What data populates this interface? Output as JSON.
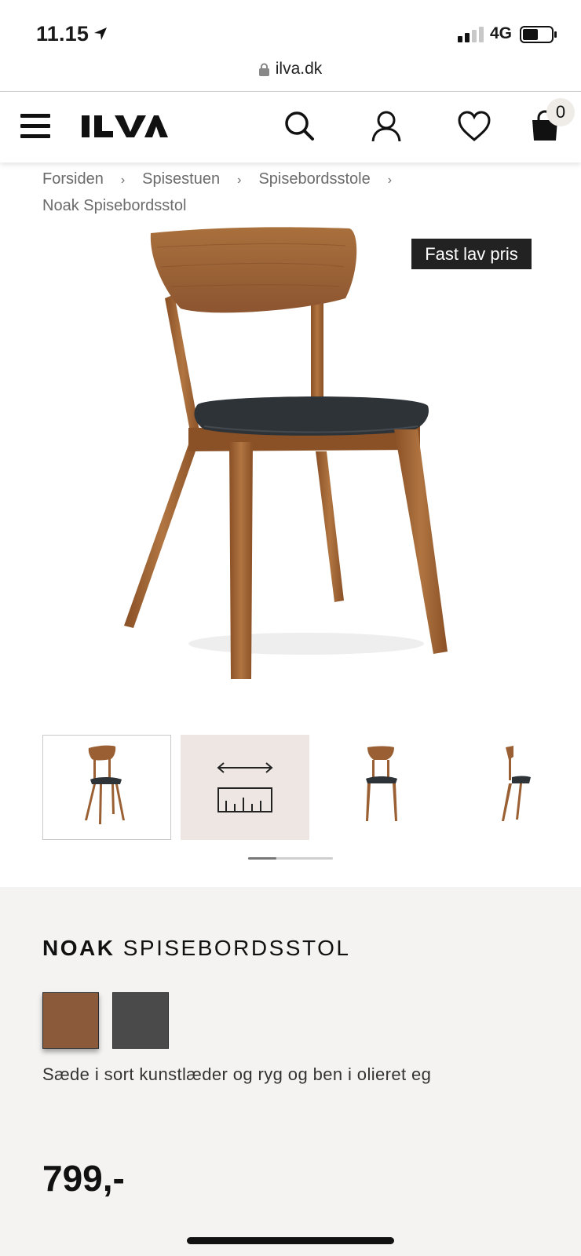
{
  "status": {
    "time": "11.15",
    "network": "4G"
  },
  "browser": {
    "url": "ilva.dk"
  },
  "header": {
    "logo": "ILVA",
    "cart_count": "0"
  },
  "breadcrumb": [
    "Forsiden",
    "Spisestuen",
    "Spisebordsstole",
    "Noak Spisebordsstol"
  ],
  "product": {
    "badge": "Fast lav pris",
    "title_bold": "NOAK",
    "title_rest": "SPISEBORDSSTOL",
    "swatches": [
      {
        "name": "Oak",
        "color": "#8a5a3b",
        "selected": true
      },
      {
        "name": "Grey",
        "color": "#4a4a4a",
        "selected": false
      }
    ],
    "description": "Sæde i sort kunstlæder og ryg og ben i olieret eg",
    "price": "799,-"
  },
  "thumbnails": [
    "chair-front",
    "measurements",
    "chair-front",
    "chair-side"
  ],
  "colors": {
    "wood": "#9a5f33",
    "seat": "#2e3338",
    "dark": "#111111"
  }
}
